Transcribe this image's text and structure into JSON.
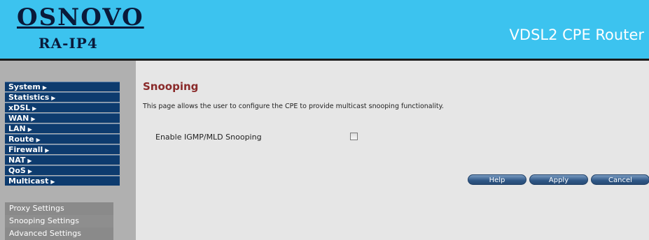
{
  "header": {
    "brand": "OSNOVO",
    "model": "RA-IP4",
    "product_title": "VDSL2 CPE Router"
  },
  "sidebar": {
    "menu": [
      {
        "label": "System",
        "arrow": "▶"
      },
      {
        "label": "Statistics",
        "arrow": "▶"
      },
      {
        "label": "xDSL",
        "arrow": "▶"
      },
      {
        "label": "WAN",
        "arrow": "▶"
      },
      {
        "label": "LAN",
        "arrow": "▶"
      },
      {
        "label": "Route",
        "arrow": "▶"
      },
      {
        "label": "Firewall",
        "arrow": "▶"
      },
      {
        "label": "NAT",
        "arrow": "▶"
      },
      {
        "label": "QoS",
        "arrow": "▶"
      },
      {
        "label": "Multicast",
        "arrow": "▶"
      }
    ],
    "submenu": [
      {
        "label": "Proxy Settings"
      },
      {
        "label": "Snooping Settings"
      },
      {
        "label": "Advanced Settings"
      }
    ]
  },
  "main": {
    "title": "Snooping",
    "description": "This page allows the user to configure the CPE to provide multicast snooping functionality.",
    "snooping_label": "Enable IGMP/MLD Snooping",
    "snooping_enabled": false,
    "buttons": {
      "help": "Help",
      "apply": "Apply",
      "cancel": "Cancel"
    }
  }
}
